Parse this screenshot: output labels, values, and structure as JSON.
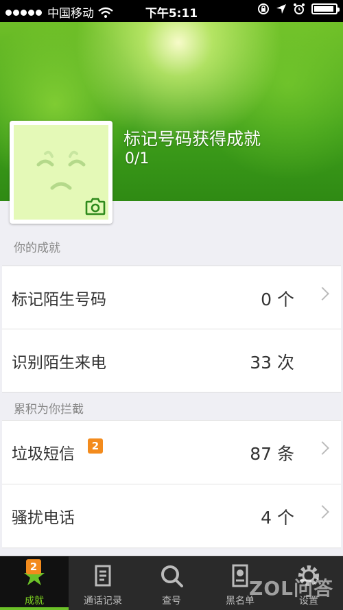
{
  "status_bar": {
    "carrier": "中国移动",
    "time": "下午5:11"
  },
  "hero": {
    "title": "标记号码获得成就",
    "count": "0/1"
  },
  "achievements": {
    "section_label": "你的成就",
    "rows": [
      {
        "label": "标记陌生号码",
        "value": "0 个"
      },
      {
        "label": "识别陌生来电",
        "value": "33 次"
      }
    ]
  },
  "blocked": {
    "section_label": "累积为你拦截",
    "rows": [
      {
        "label": "垃圾短信",
        "value": "87 条",
        "badge": "2"
      },
      {
        "label": "骚扰电话",
        "value": "4 个"
      }
    ]
  },
  "tabs": [
    {
      "label": "成就",
      "badge": "2",
      "icon": "star-icon",
      "active": true
    },
    {
      "label": "通话记录",
      "icon": "call-log-icon"
    },
    {
      "label": "查号",
      "icon": "search-icon"
    },
    {
      "label": "黑名单",
      "icon": "blacklist-icon"
    },
    {
      "label": "设置",
      "icon": "gear-icon"
    }
  ],
  "watermark": "ZOL问答",
  "colors": {
    "accent": "#6cc128",
    "badge": "#f38b1d",
    "tabbar": "#2a2a2a"
  }
}
